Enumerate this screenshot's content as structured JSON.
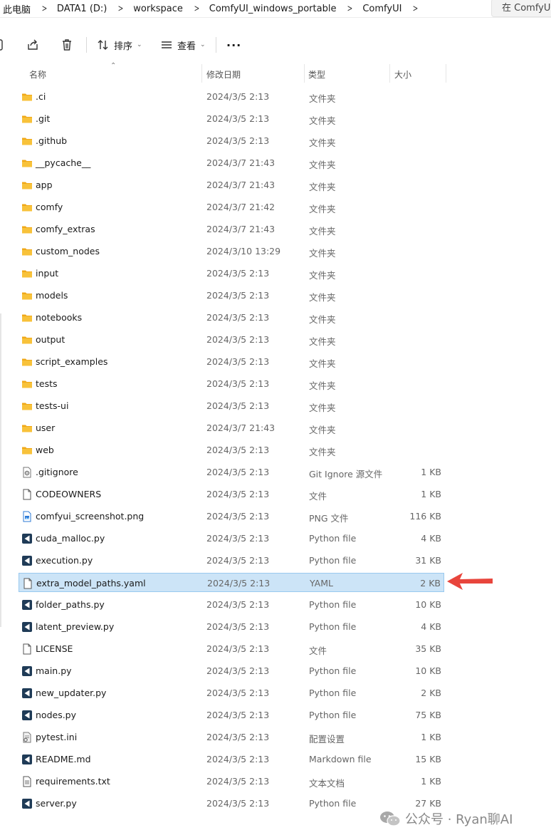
{
  "breadcrumbs": [
    "此电脑",
    "DATA1 (D:)",
    "workspace",
    "ComfyUI_windows_portable",
    "ComfyUI"
  ],
  "search_placeholder": "在 ComfyUI",
  "toolbar": {
    "sort_label": "排序",
    "view_label": "查看",
    "more_label": "···"
  },
  "columns": {
    "name": "名称",
    "date": "修改日期",
    "type": "类型",
    "size": "大小"
  },
  "files": [
    {
      "name": ".ci",
      "date": "2024/3/5 2:13",
      "type": "文件夹",
      "size": "",
      "icon": "folder-icon"
    },
    {
      "name": ".git",
      "date": "2024/3/5 2:13",
      "type": "文件夹",
      "size": "",
      "icon": "folder-icon"
    },
    {
      "name": ".github",
      "date": "2024/3/5 2:13",
      "type": "文件夹",
      "size": "",
      "icon": "folder-icon"
    },
    {
      "name": "__pycache__",
      "date": "2024/3/7 21:43",
      "type": "文件夹",
      "size": "",
      "icon": "folder-icon"
    },
    {
      "name": "app",
      "date": "2024/3/7 21:43",
      "type": "文件夹",
      "size": "",
      "icon": "folder-icon"
    },
    {
      "name": "comfy",
      "date": "2024/3/7 21:42",
      "type": "文件夹",
      "size": "",
      "icon": "folder-icon"
    },
    {
      "name": "comfy_extras",
      "date": "2024/3/7 21:43",
      "type": "文件夹",
      "size": "",
      "icon": "folder-icon"
    },
    {
      "name": "custom_nodes",
      "date": "2024/3/10 13:29",
      "type": "文件夹",
      "size": "",
      "icon": "folder-icon"
    },
    {
      "name": "input",
      "date": "2024/3/5 2:13",
      "type": "文件夹",
      "size": "",
      "icon": "folder-icon"
    },
    {
      "name": "models",
      "date": "2024/3/5 2:13",
      "type": "文件夹",
      "size": "",
      "icon": "folder-icon"
    },
    {
      "name": "notebooks",
      "date": "2024/3/5 2:13",
      "type": "文件夹",
      "size": "",
      "icon": "folder-icon"
    },
    {
      "name": "output",
      "date": "2024/3/5 2:13",
      "type": "文件夹",
      "size": "",
      "icon": "folder-icon"
    },
    {
      "name": "script_examples",
      "date": "2024/3/5 2:13",
      "type": "文件夹",
      "size": "",
      "icon": "folder-icon"
    },
    {
      "name": "tests",
      "date": "2024/3/5 2:13",
      "type": "文件夹",
      "size": "",
      "icon": "folder-icon"
    },
    {
      "name": "tests-ui",
      "date": "2024/3/5 2:13",
      "type": "文件夹",
      "size": "",
      "icon": "folder-icon"
    },
    {
      "name": "user",
      "date": "2024/3/7 21:43",
      "type": "文件夹",
      "size": "",
      "icon": "folder-icon"
    },
    {
      "name": "web",
      "date": "2024/3/5 2:13",
      "type": "文件夹",
      "size": "",
      "icon": "folder-icon"
    },
    {
      "name": ".gitignore",
      "date": "2024/3/5 2:13",
      "type": "Git Ignore 源文件",
      "size": "1 KB",
      "icon": "gear-file-icon"
    },
    {
      "name": "CODEOWNERS",
      "date": "2024/3/5 2:13",
      "type": "文件",
      "size": "1 KB",
      "icon": "blank-file-icon"
    },
    {
      "name": "comfyui_screenshot.png",
      "date": "2024/3/5 2:13",
      "type": "PNG 文件",
      "size": "116 KB",
      "icon": "image-file-icon"
    },
    {
      "name": "cuda_malloc.py",
      "date": "2024/3/5 2:13",
      "type": "Python file",
      "size": "4 KB",
      "icon": "python-file-icon"
    },
    {
      "name": "execution.py",
      "date": "2024/3/5 2:13",
      "type": "Python file",
      "size": "31 KB",
      "icon": "python-file-icon"
    },
    {
      "name": "extra_model_paths.yaml",
      "date": "2024/3/5 2:13",
      "type": "YAML",
      "size": "2 KB",
      "icon": "blank-file-icon",
      "selected": true
    },
    {
      "name": "folder_paths.py",
      "date": "2024/3/5 2:13",
      "type": "Python file",
      "size": "10 KB",
      "icon": "python-file-icon"
    },
    {
      "name": "latent_preview.py",
      "date": "2024/3/5 2:13",
      "type": "Python file",
      "size": "4 KB",
      "icon": "python-file-icon"
    },
    {
      "name": "LICENSE",
      "date": "2024/3/5 2:13",
      "type": "文件",
      "size": "35 KB",
      "icon": "blank-file-icon"
    },
    {
      "name": "main.py",
      "date": "2024/3/5 2:13",
      "type": "Python file",
      "size": "10 KB",
      "icon": "python-file-icon"
    },
    {
      "name": "new_updater.py",
      "date": "2024/3/5 2:13",
      "type": "Python file",
      "size": "2 KB",
      "icon": "python-file-icon"
    },
    {
      "name": "nodes.py",
      "date": "2024/3/5 2:13",
      "type": "Python file",
      "size": "75 KB",
      "icon": "python-file-icon"
    },
    {
      "name": "pytest.ini",
      "date": "2024/3/5 2:13",
      "type": "配置设置",
      "size": "1 KB",
      "icon": "settings-file-icon"
    },
    {
      "name": "README.md",
      "date": "2024/3/5 2:13",
      "type": "Markdown file",
      "size": "15 KB",
      "icon": "markdown-file-icon"
    },
    {
      "name": "requirements.txt",
      "date": "2024/3/5 2:13",
      "type": "文本文档",
      "size": "1 KB",
      "icon": "text-file-icon"
    },
    {
      "name": "server.py",
      "date": "2024/3/5 2:13",
      "type": "Python file",
      "size": "27 KB",
      "icon": "python-file-icon"
    }
  ],
  "watermark": "公众号 · Ryan聊AI",
  "colors": {
    "selection": "#cce4f7",
    "selection_border": "#99c9ef",
    "folder": "#f8c23a",
    "arrow": "#e8453c"
  }
}
